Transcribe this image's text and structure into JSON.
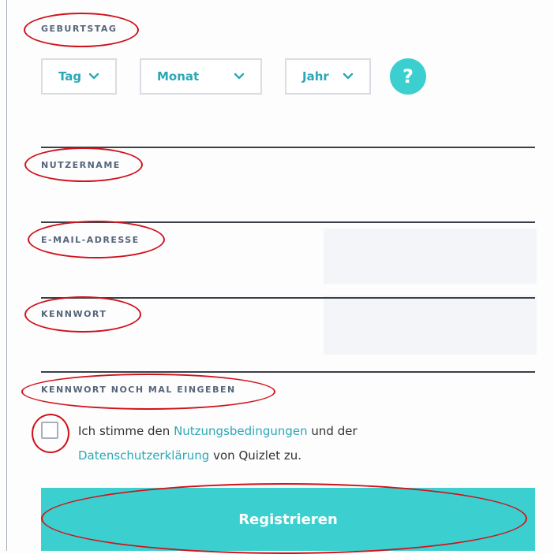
{
  "colors": {
    "accent": "#3ccfcf",
    "link": "#2ba8b6",
    "annotation": "#d0121b",
    "label": "#56657a"
  },
  "birthday": {
    "label": "GEBURTSTAG",
    "day": "Tag",
    "month": "Monat",
    "year": "Jahr",
    "help": "?"
  },
  "fields": {
    "username_label": "NUTZERNAME",
    "email_label": "E-MAIL-ADRESSE",
    "password_label": "KENNWORT",
    "password_repeat_label": "KENNWORT NOCH MAL EINGEBEN"
  },
  "terms": {
    "prefix": "Ich stimme den ",
    "terms_link": "Nutzungsbedingungen",
    "middle": " und der",
    "privacy_link": "Datenschutzerklärung",
    "suffix": " von Quizlet zu."
  },
  "submit": {
    "label": "Registrieren"
  },
  "icons": {
    "dropdown": "chevron-down-icon",
    "help": "question-mark-icon"
  }
}
